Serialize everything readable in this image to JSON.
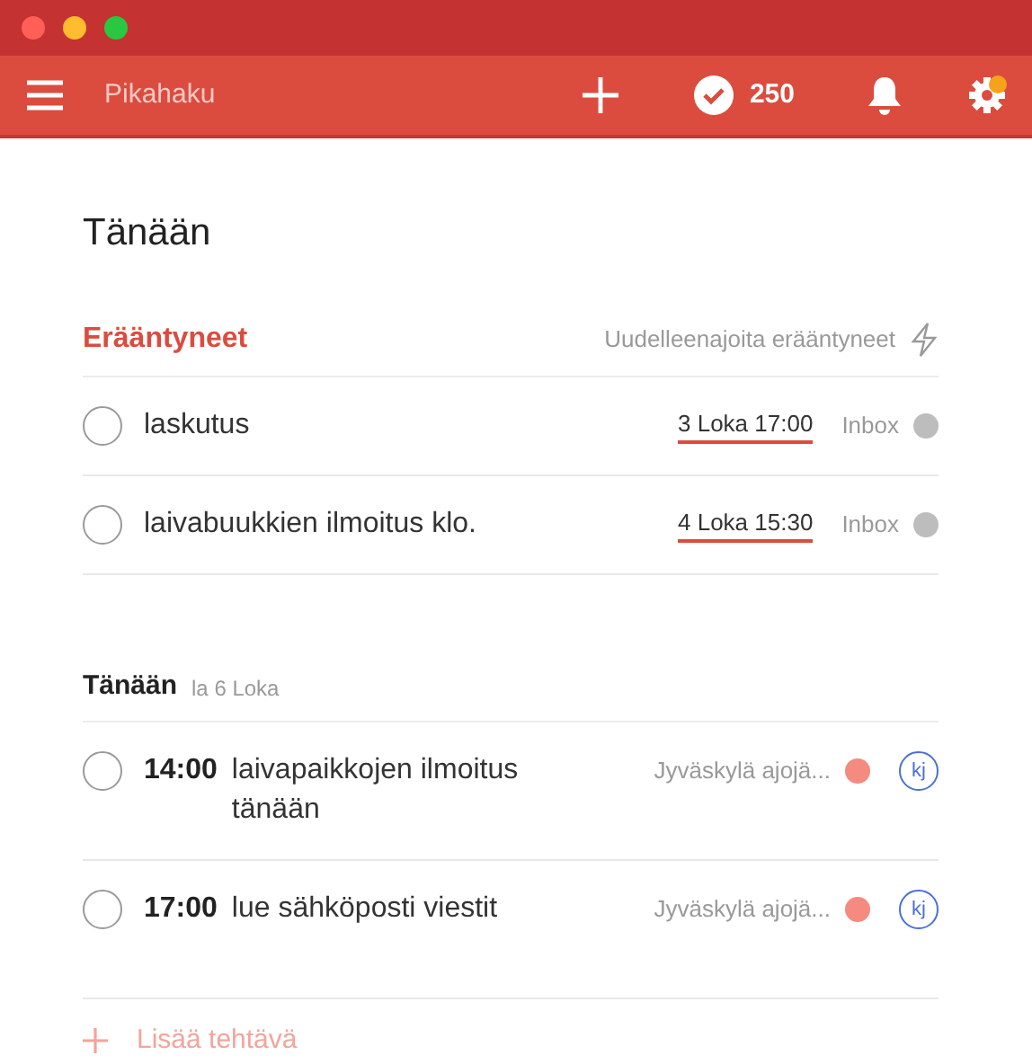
{
  "toolbar": {
    "search": {
      "placeholder": "Pikahaku"
    },
    "karma": "250",
    "settings_notification": true
  },
  "page_title": "Tänään",
  "overdue": {
    "title": "Erääntyneet",
    "reschedule": "Uudelleenajoita erääntyneet",
    "tasks": [
      {
        "text": "laskutus",
        "checked": false,
        "due": "3 Loka 17:00",
        "project": "Inbox",
        "color": "#bdbdbd"
      },
      {
        "text": "laivabuukkien ilmoitus klo.",
        "checked": false,
        "due": "4 Loka 15:30",
        "project": "Inbox",
        "color": "#bdbdbd"
      }
    ]
  },
  "today": {
    "title": "Tänään",
    "date": "la 6 Loka",
    "tasks": [
      {
        "time": "14:00",
        "text": "laivapaikkojen ilmoitus tänään",
        "checked": false,
        "project": "Jyväskylä ajojä...",
        "color": "#f58a80",
        "assignee": "kj"
      },
      {
        "time": "17:00",
        "text": "lue sähköposti viestit",
        "checked": false,
        "project": "Jyväskylä ajojä...",
        "color": "#f58a80",
        "assignee": "kj"
      }
    ]
  },
  "add_task": "Lisää tehtävä"
}
